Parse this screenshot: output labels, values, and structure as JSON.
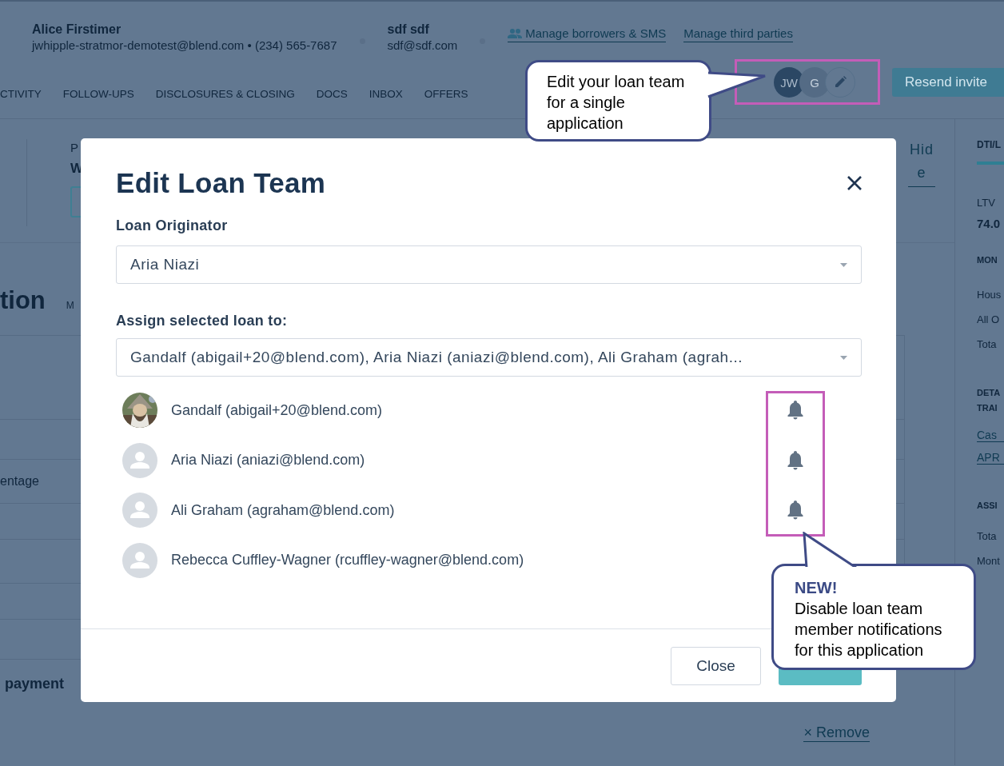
{
  "header": {
    "borrowers": [
      {
        "name": "Alice Firstimer",
        "contact": "jwhipple-stratmor-demotest@blend.com • (234) 565-7687"
      },
      {
        "name": "sdf sdf",
        "contact": "sdf@sdf.com"
      }
    ],
    "links": [
      {
        "label": "Manage borrowers & SMS",
        "kind": "people"
      },
      {
        "label": "Manage third parties",
        "kind": "plain"
      }
    ],
    "team_avatars": [
      "JW",
      "G"
    ],
    "resend_button": "Resend invite"
  },
  "tabs": [
    {
      "label": "CTIVITY",
      "selected": false
    },
    {
      "label": "FOLLOW-UPS",
      "selected": false
    },
    {
      "label": "DISCLOSURES & CLOSING",
      "selected": false
    },
    {
      "label": "DOCS",
      "selected": false
    },
    {
      "label": "INBOX",
      "selected": false
    },
    {
      "label": "OFFERS",
      "selected": false
    }
  ],
  "summary": {
    "label": "P",
    "value": "W",
    "hide_link": "Hide"
  },
  "section": {
    "title": "tion",
    "column": "M",
    "row_texts": [
      "entage",
      "payment"
    ],
    "remove_link": "× Remove"
  },
  "side_panel": {
    "tab": "DTI/L",
    "ltv_label": "LTV",
    "ltv_value": "74.0",
    "monthly_heading": "MON",
    "monthly_rows": [
      "Hous",
      "All O",
      "Tota"
    ],
    "details_heading": [
      "DETA",
      "TRAI"
    ],
    "links": [
      "Cas",
      "APR"
    ],
    "assets_heading": "ASSI",
    "assets_rows": [
      "Tota",
      "Mont"
    ]
  },
  "modal": {
    "title": "Edit Loan Team",
    "originator_label": "Loan Originator",
    "originator_value": "Aria Niazi",
    "assign_label": "Assign selected loan to:",
    "assign_value": "Gandalf (abigail+20@blend.com), Aria Niazi (aniazi@blend.com), Ali Graham (agrah...",
    "members": [
      {
        "name": "Gandalf (abigail+20@blend.com)",
        "bell": true
      },
      {
        "name": "Aria Niazi (aniazi@blend.com)",
        "kind": "generic",
        "bell": true
      },
      {
        "name": "Ali Graham (agraham@blend.com)",
        "kind": "generic",
        "bell": true
      },
      {
        "name": "Rebecca Cuffley-Wagner (rcuffley-wagner@blend.com)",
        "kind": "generic",
        "bell": false
      }
    ],
    "close_button": "Close"
  },
  "callouts": [
    {
      "text": "Edit your loan team for a single application"
    },
    {
      "badge": "NEW!",
      "text": "Disable loan team member notifications for this application"
    }
  ]
}
